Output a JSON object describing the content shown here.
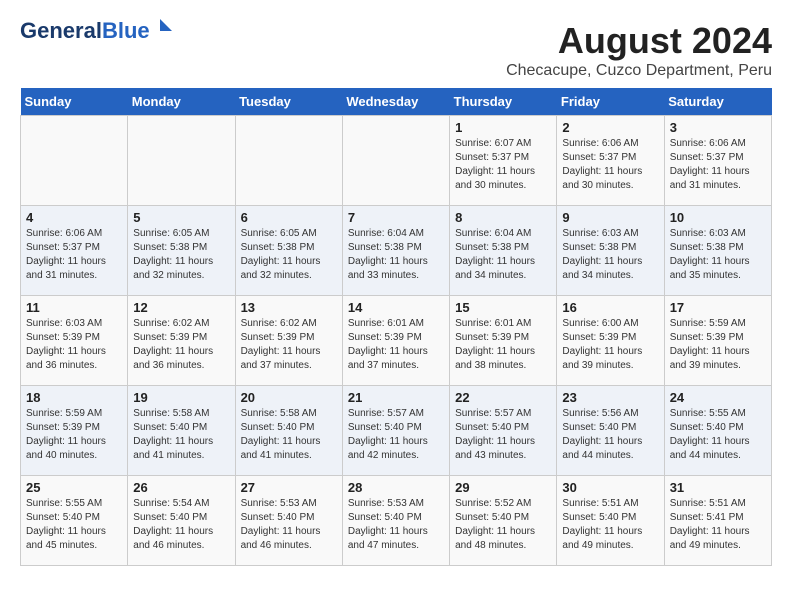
{
  "logo": {
    "line1": "General",
    "line2": "Blue"
  },
  "title": "August 2024",
  "subtitle": "Checacupe, Cuzco Department, Peru",
  "days_of_week": [
    "Sunday",
    "Monday",
    "Tuesday",
    "Wednesday",
    "Thursday",
    "Friday",
    "Saturday"
  ],
  "weeks": [
    [
      {
        "day": "",
        "info": ""
      },
      {
        "day": "",
        "info": ""
      },
      {
        "day": "",
        "info": ""
      },
      {
        "day": "",
        "info": ""
      },
      {
        "day": "1",
        "info": "Sunrise: 6:07 AM\nSunset: 5:37 PM\nDaylight: 11 hours\nand 30 minutes."
      },
      {
        "day": "2",
        "info": "Sunrise: 6:06 AM\nSunset: 5:37 PM\nDaylight: 11 hours\nand 30 minutes."
      },
      {
        "day": "3",
        "info": "Sunrise: 6:06 AM\nSunset: 5:37 PM\nDaylight: 11 hours\nand 31 minutes."
      }
    ],
    [
      {
        "day": "4",
        "info": "Sunrise: 6:06 AM\nSunset: 5:37 PM\nDaylight: 11 hours\nand 31 minutes."
      },
      {
        "day": "5",
        "info": "Sunrise: 6:05 AM\nSunset: 5:38 PM\nDaylight: 11 hours\nand 32 minutes."
      },
      {
        "day": "6",
        "info": "Sunrise: 6:05 AM\nSunset: 5:38 PM\nDaylight: 11 hours\nand 32 minutes."
      },
      {
        "day": "7",
        "info": "Sunrise: 6:04 AM\nSunset: 5:38 PM\nDaylight: 11 hours\nand 33 minutes."
      },
      {
        "day": "8",
        "info": "Sunrise: 6:04 AM\nSunset: 5:38 PM\nDaylight: 11 hours\nand 34 minutes."
      },
      {
        "day": "9",
        "info": "Sunrise: 6:03 AM\nSunset: 5:38 PM\nDaylight: 11 hours\nand 34 minutes."
      },
      {
        "day": "10",
        "info": "Sunrise: 6:03 AM\nSunset: 5:38 PM\nDaylight: 11 hours\nand 35 minutes."
      }
    ],
    [
      {
        "day": "11",
        "info": "Sunrise: 6:03 AM\nSunset: 5:39 PM\nDaylight: 11 hours\nand 36 minutes."
      },
      {
        "day": "12",
        "info": "Sunrise: 6:02 AM\nSunset: 5:39 PM\nDaylight: 11 hours\nand 36 minutes."
      },
      {
        "day": "13",
        "info": "Sunrise: 6:02 AM\nSunset: 5:39 PM\nDaylight: 11 hours\nand 37 minutes."
      },
      {
        "day": "14",
        "info": "Sunrise: 6:01 AM\nSunset: 5:39 PM\nDaylight: 11 hours\nand 37 minutes."
      },
      {
        "day": "15",
        "info": "Sunrise: 6:01 AM\nSunset: 5:39 PM\nDaylight: 11 hours\nand 38 minutes."
      },
      {
        "day": "16",
        "info": "Sunrise: 6:00 AM\nSunset: 5:39 PM\nDaylight: 11 hours\nand 39 minutes."
      },
      {
        "day": "17",
        "info": "Sunrise: 5:59 AM\nSunset: 5:39 PM\nDaylight: 11 hours\nand 39 minutes."
      }
    ],
    [
      {
        "day": "18",
        "info": "Sunrise: 5:59 AM\nSunset: 5:39 PM\nDaylight: 11 hours\nand 40 minutes."
      },
      {
        "day": "19",
        "info": "Sunrise: 5:58 AM\nSunset: 5:40 PM\nDaylight: 11 hours\nand 41 minutes."
      },
      {
        "day": "20",
        "info": "Sunrise: 5:58 AM\nSunset: 5:40 PM\nDaylight: 11 hours\nand 41 minutes."
      },
      {
        "day": "21",
        "info": "Sunrise: 5:57 AM\nSunset: 5:40 PM\nDaylight: 11 hours\nand 42 minutes."
      },
      {
        "day": "22",
        "info": "Sunrise: 5:57 AM\nSunset: 5:40 PM\nDaylight: 11 hours\nand 43 minutes."
      },
      {
        "day": "23",
        "info": "Sunrise: 5:56 AM\nSunset: 5:40 PM\nDaylight: 11 hours\nand 44 minutes."
      },
      {
        "day": "24",
        "info": "Sunrise: 5:55 AM\nSunset: 5:40 PM\nDaylight: 11 hours\nand 44 minutes."
      }
    ],
    [
      {
        "day": "25",
        "info": "Sunrise: 5:55 AM\nSunset: 5:40 PM\nDaylight: 11 hours\nand 45 minutes."
      },
      {
        "day": "26",
        "info": "Sunrise: 5:54 AM\nSunset: 5:40 PM\nDaylight: 11 hours\nand 46 minutes."
      },
      {
        "day": "27",
        "info": "Sunrise: 5:53 AM\nSunset: 5:40 PM\nDaylight: 11 hours\nand 46 minutes."
      },
      {
        "day": "28",
        "info": "Sunrise: 5:53 AM\nSunset: 5:40 PM\nDaylight: 11 hours\nand 47 minutes."
      },
      {
        "day": "29",
        "info": "Sunrise: 5:52 AM\nSunset: 5:40 PM\nDaylight: 11 hours\nand 48 minutes."
      },
      {
        "day": "30",
        "info": "Sunrise: 5:51 AM\nSunset: 5:40 PM\nDaylight: 11 hours\nand 49 minutes."
      },
      {
        "day": "31",
        "info": "Sunrise: 5:51 AM\nSunset: 5:41 PM\nDaylight: 11 hours\nand 49 minutes."
      }
    ]
  ]
}
